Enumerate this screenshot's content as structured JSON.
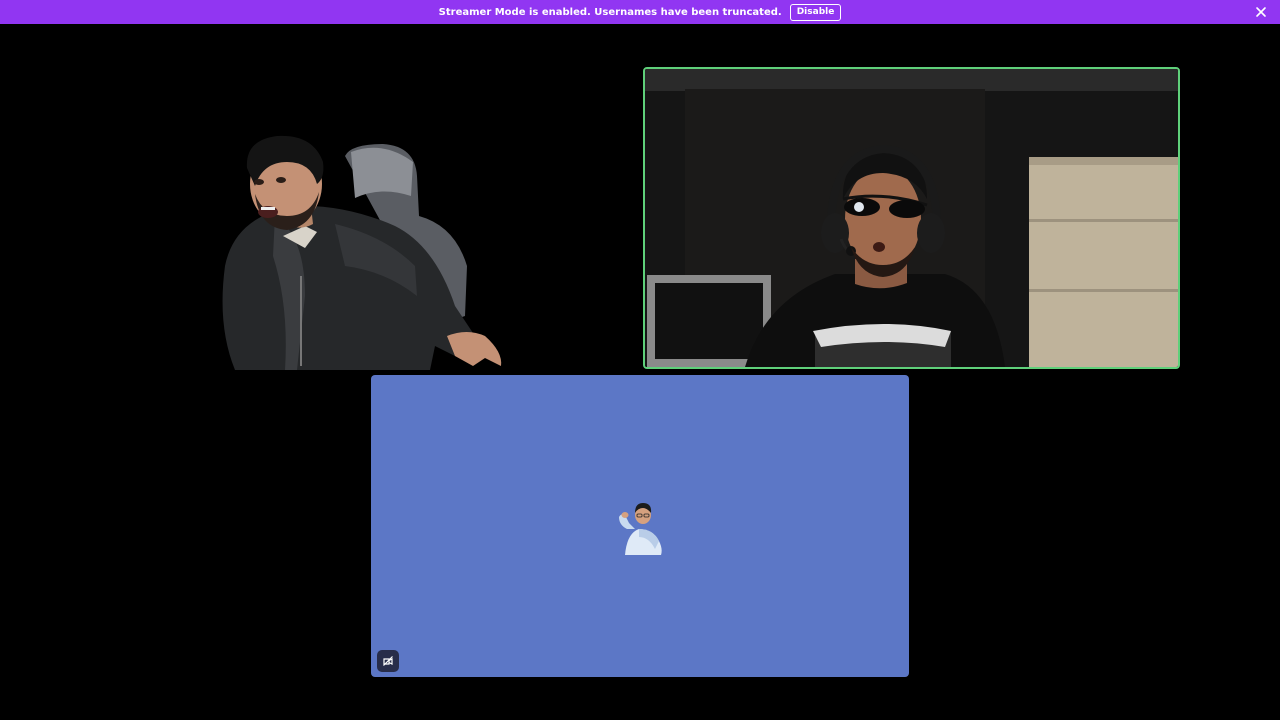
{
  "notice": {
    "message": "Streamer Mode is enabled. Usernames have been truncated.",
    "button_label": "Disable",
    "close_icon": "close-icon",
    "color": "#9136f2"
  },
  "tiles": [
    {
      "kind": "video",
      "description_icon": "video-feed",
      "border": "none"
    },
    {
      "kind": "video",
      "speaking": true,
      "border_color": "#5fd07a"
    },
    {
      "kind": "avatar",
      "background": "#5c77c6",
      "corner_button_icon": "video-off-icon"
    }
  ]
}
